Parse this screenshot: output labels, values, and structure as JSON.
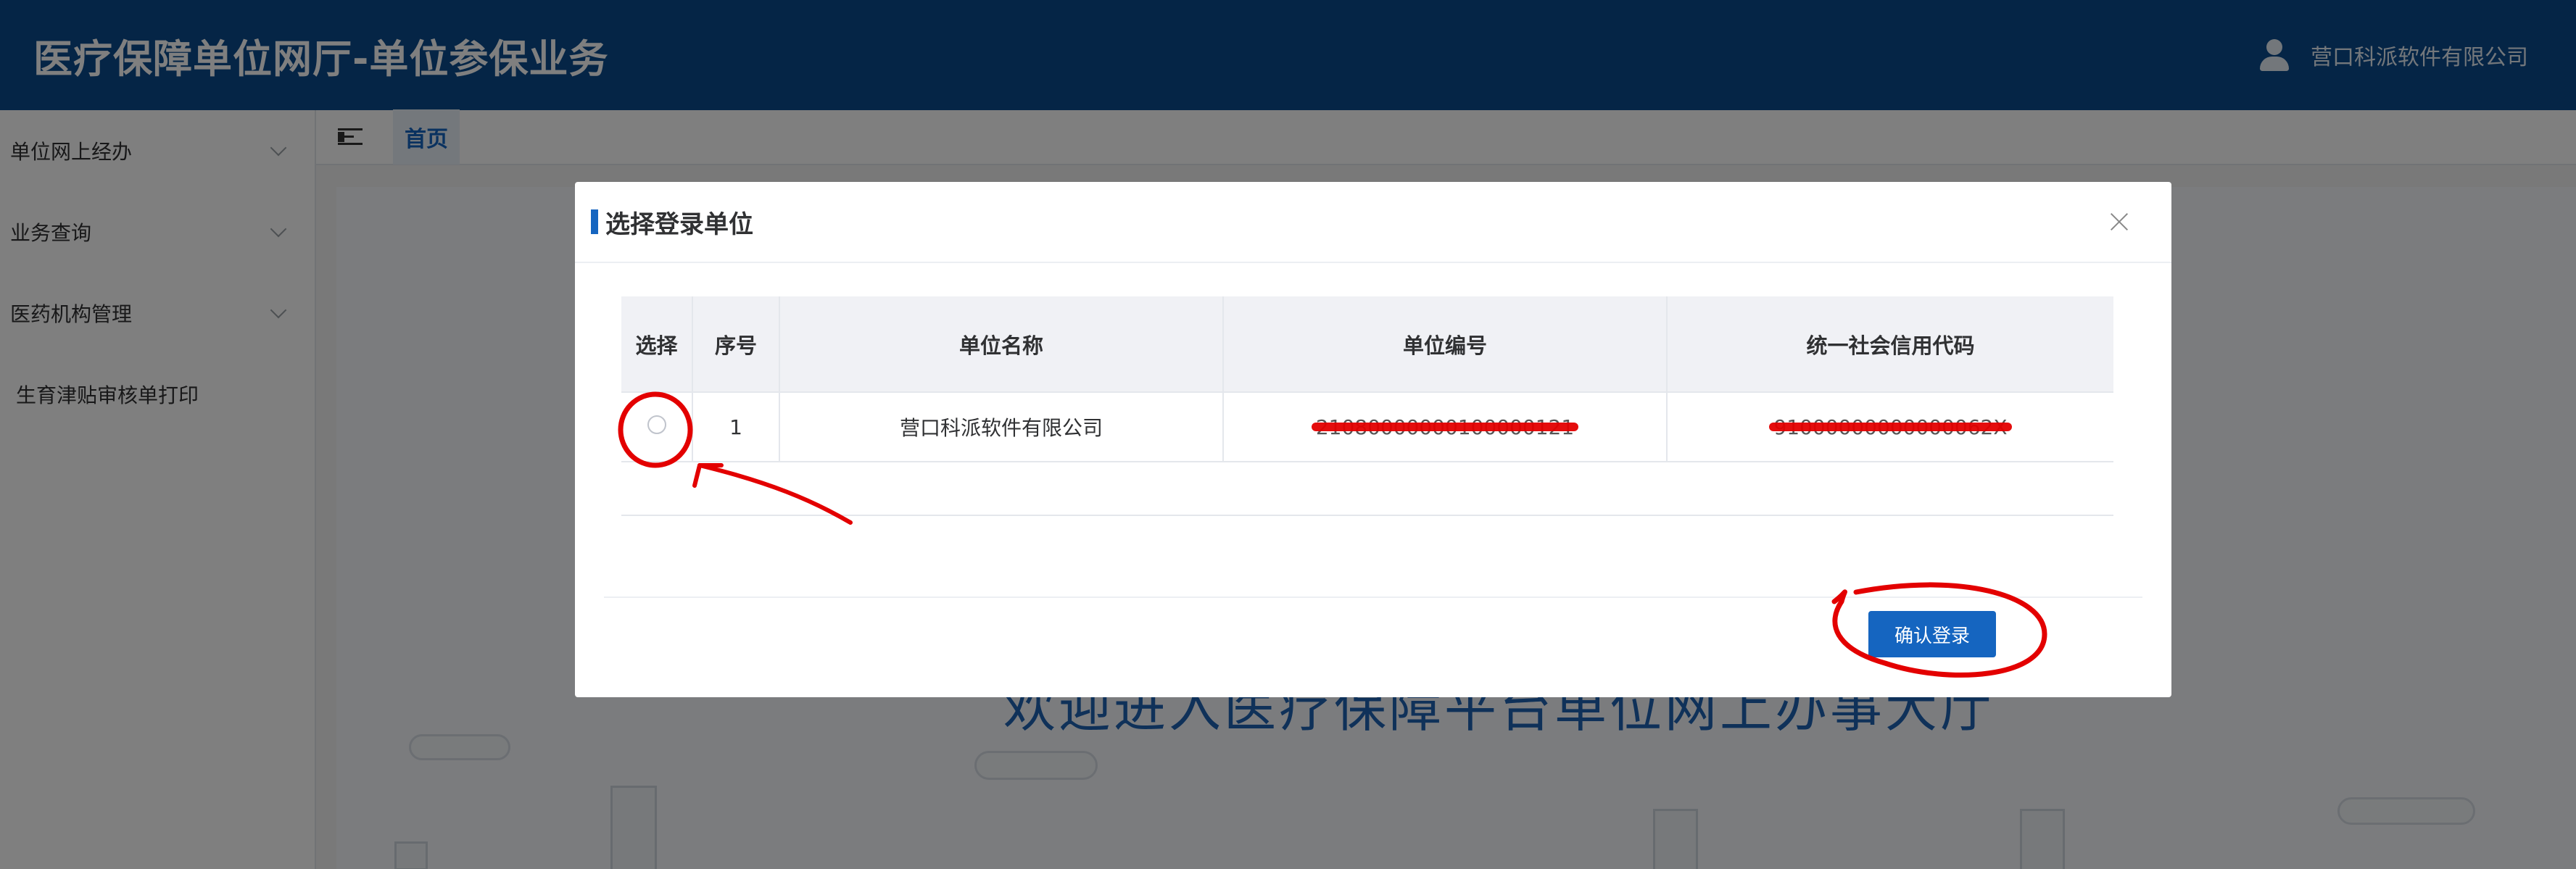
{
  "header": {
    "title": "医疗保障单位网厅-单位参保业务",
    "company": "营口科派软件有限公司",
    "user_icon": "user-icon"
  },
  "sidebar": {
    "items": [
      {
        "label": "单位网上经办",
        "icon": "chevron-down-icon"
      },
      {
        "label": "业务查询",
        "icon": "chevron-down-icon"
      },
      {
        "label": "医药机构管理",
        "icon": "chevron-down-icon"
      },
      {
        "label": "生育津贴审核单打印"
      }
    ]
  },
  "topbar": {
    "menu_icon": "collapse-menu-icon",
    "home_tab": "首页"
  },
  "background": {
    "welcome_text": "欢迎进入医疗保障平台单位网上办事大厅"
  },
  "modal": {
    "title": "选择登录单位",
    "close_icon": "close-icon",
    "columns": [
      "选择",
      "序号",
      "单位名称",
      "单位编号",
      "统一社会信用代码"
    ],
    "rows": [
      {
        "selected": false,
        "index": "1",
        "name": "营口科派软件有限公司",
        "unit_code": "21080000000100000121",
        "credit_code": "91000000000000062X"
      }
    ],
    "confirm_button": "确认登录"
  },
  "colors": {
    "header_bg": "#0a4a8c",
    "accent": "#1565c0",
    "annotation": "#e30000"
  }
}
